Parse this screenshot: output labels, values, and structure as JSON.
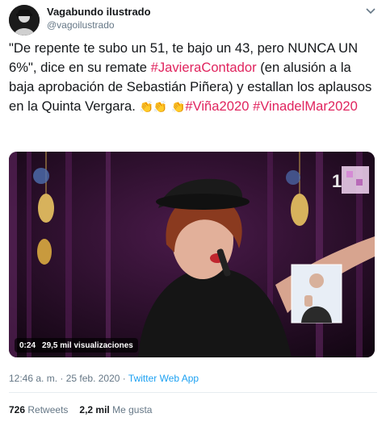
{
  "author": {
    "name": "Vagabundo ilustrado",
    "handle": "@vagoilustrado"
  },
  "tweet": {
    "text_1": "\"De repente te subo un 51, te bajo un 43, pero NUNCA UN 6%\", dice en su remate ",
    "hashtag_1": "#JavieraContador",
    "text_2": " (en alusión a la baja aprobación de Sebastián Piñera) y estallan los aplausos en la Quinta Vergara. ",
    "emoji_clap": "👏",
    "hashtag_2": "#Viña2020",
    "hashtag_3": "#VinadelMar2020"
  },
  "video": {
    "duration": "0:24",
    "views": "29,5 mil visualizaciones"
  },
  "meta": {
    "time": "12:46 a. m.",
    "separator": " · ",
    "date": "25 feb. 2020",
    "source": "Twitter Web App"
  },
  "stats": {
    "retweets_count": "726",
    "retweets_label": "Retweets",
    "likes_count": "2,2 mil",
    "likes_label": "Me gusta"
  },
  "colors": {
    "hashtag": "#e0245e",
    "link": "#1da1f2",
    "muted": "#657786"
  },
  "icons": {
    "caret": "chevron-down-icon",
    "avatar": "avatar"
  }
}
